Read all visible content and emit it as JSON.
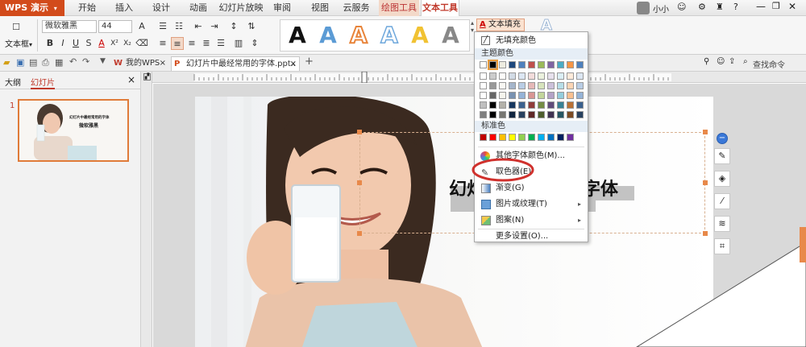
{
  "menubar": {
    "app_button": "WPS 演示",
    "tabs": [
      "开始",
      "插入",
      "设计",
      "动画",
      "幻灯片放映",
      "审阅",
      "视图",
      "云服务",
      "绘图工具",
      "文本工具"
    ],
    "user_name": "小小"
  },
  "ribbon": {
    "font_name": "微软雅黑",
    "font_size": "44",
    "textbox_label": "文本框",
    "text_fill_label": "文本填充",
    "bold": "B",
    "italic": "I",
    "underline": "U",
    "strike": "S",
    "superscript": "X²",
    "subscript": "X₂",
    "font_color_letter": "A",
    "wordart_letters": [
      "A",
      "A",
      "A",
      "A",
      "A",
      "A"
    ]
  },
  "qabar": {
    "tabs": [
      "我的WPS",
      "幻灯片中最经常用的字体.pptx *"
    ],
    "add_tab": "+",
    "search_placeholder": "查找命令"
  },
  "left_panel": {
    "tabs": [
      "大纲",
      "幻灯片"
    ],
    "close": "×",
    "slide_number": "1",
    "thumb_title": "幻灯片中最经常用的字体",
    "thumb_subtitle": "微软雅黑"
  },
  "slide": {
    "title_visible_left": "幻灯",
    "title_visible_right": "字体"
  },
  "dropdown": {
    "no_fill": "无填充颜色",
    "theme_colors_header": "主题颜色",
    "standard_colors_header": "标准色",
    "more_colors": "其他字体颜色(M)...",
    "eyedropper": "取色器(E)",
    "gradient": "渐变(G)",
    "picture_texture": "图片或纹理(T)",
    "pattern": "图案(N)",
    "more_settings": "更多设置(O)...",
    "theme_top_row": [
      "#ffffff",
      "#000000",
      "#eeece1",
      "#1f497d",
      "#4f81bd",
      "#c0504d",
      "#9bbb59",
      "#8064a2",
      "#4bacc6",
      "#f79646",
      "#4f81bd"
    ],
    "standard_row": [
      "#c00000",
      "#ff0000",
      "#ffc000",
      "#ffff00",
      "#92d050",
      "#00b050",
      "#00b0f0",
      "#0070c0",
      "#002060",
      "#7030a0"
    ]
  },
  "colors": {
    "accent": "#d24b1b",
    "highlight_ring": "#d0312d"
  }
}
